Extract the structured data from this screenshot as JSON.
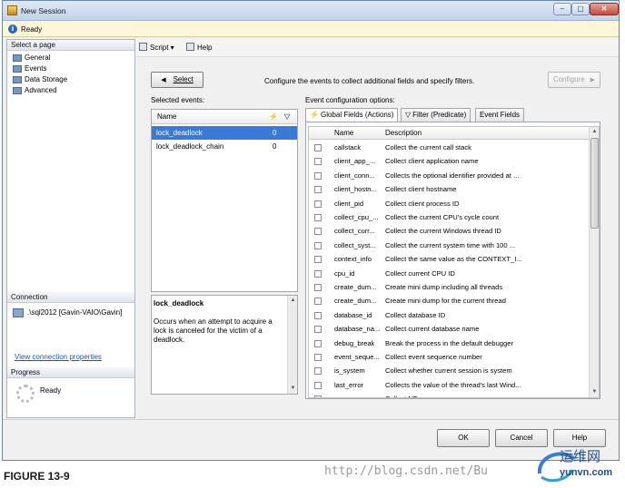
{
  "window": {
    "title": "New Session",
    "status": "Ready"
  },
  "left_pane": {
    "select_page_header": "Select a page",
    "pages": [
      {
        "label": "General",
        "icon": "page-icon"
      },
      {
        "label": "Events",
        "icon": "page-icon"
      },
      {
        "label": "Data Storage",
        "icon": "page-icon"
      },
      {
        "label": "Advanced",
        "icon": "page-icon"
      }
    ],
    "connection_header": "Connection",
    "connection_value": ".\\sql2012 [Gavin-VAIO\\Gavin]",
    "view_connection_link": "View connection properties",
    "progress_header": "Progress",
    "progress_status": "Ready"
  },
  "toolbar": {
    "script_label": "Script",
    "help_label": "Help"
  },
  "events": {
    "select_button": "Select",
    "instruction": "Configure the events to collect additional fields and specify filters.",
    "configure_button": "Configure",
    "selected_events_label": "Selected events:",
    "columns": {
      "name": "Name",
      "actions_icon": "lightning-icon",
      "filter_icon": "funnel-icon"
    },
    "rows": [
      {
        "name": "lock_deadlock",
        "actions": "0",
        "selected": true
      },
      {
        "name": "lock_deadlock_chain",
        "actions": "0",
        "selected": false
      }
    ],
    "description_title": "lock_deadlock",
    "description_text": "Occurs when an attempt to acquire a lock is canceled for the victim of a deadlock."
  },
  "config": {
    "label": "Event configuration options:",
    "tabs": [
      {
        "label": "Global Fields (Actions)",
        "icon": "lightning-icon",
        "active": true
      },
      {
        "label": "Filter (Predicate)",
        "icon": "funnel-icon",
        "active": false
      },
      {
        "label": "Event Fields",
        "icon": "",
        "active": false
      }
    ],
    "columns": {
      "name": "Name",
      "description": "Description"
    },
    "fields": [
      {
        "name": "callstack",
        "description": "Collect the current call stack"
      },
      {
        "name": "client_app_...",
        "description": "Collect client application name"
      },
      {
        "name": "client_conn...",
        "description": "Collects the optional identifier provided at ..."
      },
      {
        "name": "client_hostn...",
        "description": "Collect client hostname"
      },
      {
        "name": "client_pid",
        "description": "Collect client process ID"
      },
      {
        "name": "collect_cpu_...",
        "description": "Collect the current CPU's cycle count"
      },
      {
        "name": "collect_curr...",
        "description": "Collect the current Windows thread ID"
      },
      {
        "name": "collect_syst...",
        "description": "Collect the current system time with 100 ..."
      },
      {
        "name": "context_info",
        "description": "Collect the same value as the CONTEXT_I..."
      },
      {
        "name": "cpu_id",
        "description": "Collect current CPU ID"
      },
      {
        "name": "create_dum...",
        "description": "Create mini dump including all threads"
      },
      {
        "name": "create_dum...",
        "description": "Create mini dump for the current thread"
      },
      {
        "name": "database_id",
        "description": "Collect database ID"
      },
      {
        "name": "database_na...",
        "description": "Collect current database name"
      },
      {
        "name": "debug_break",
        "description": "Break the process in the default debugger"
      },
      {
        "name": "event_seque...",
        "description": "Collect event sequence number"
      },
      {
        "name": "is_system",
        "description": "Collect whether current session is system"
      },
      {
        "name": "last_error",
        "description": "Collects the value of the thread's last Wind..."
      },
      {
        "name": "...",
        "description": "Collect NT..."
      }
    ]
  },
  "buttons": {
    "ok": "OK",
    "cancel": "Cancel",
    "help": "Help"
  },
  "caption": "FIGURE 13-9",
  "watermark": "http://blog.csdn.net/Bu",
  "logo_text": "运维网",
  "logo_url": "yunvn.com"
}
